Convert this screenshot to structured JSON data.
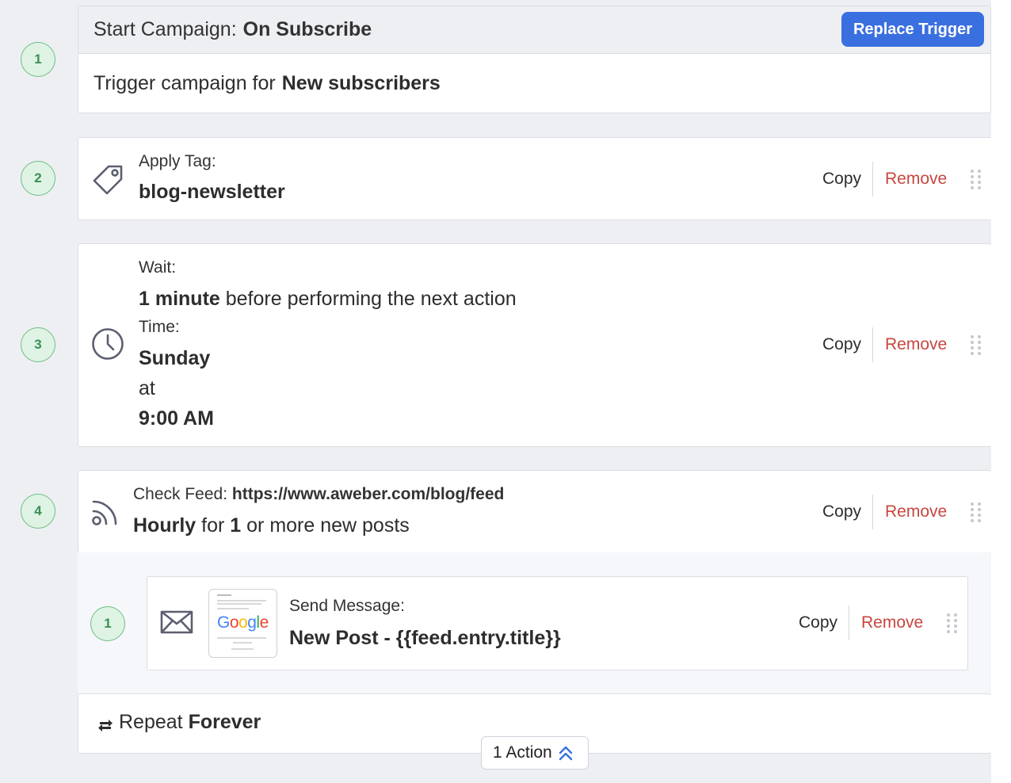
{
  "steps": {
    "n1": "1",
    "n2": "2",
    "n3": "3",
    "n4": "4",
    "nested_n1": "1"
  },
  "trigger": {
    "prefix": "Start Campaign:",
    "name": "On Subscribe",
    "replace_label": "Replace Trigger",
    "body_prefix": "Trigger campaign for",
    "body_value": "New subscribers"
  },
  "tag": {
    "label": "Apply Tag:",
    "value": "blog-newsletter"
  },
  "wait": {
    "label": "Wait:",
    "amount": "1 minute",
    "suffix": "before performing the next action",
    "time_label": "Time:",
    "day": "Sunday",
    "at": "at",
    "time": "9:00 AM"
  },
  "feed": {
    "label": "Check Feed:",
    "url": "https://www.aweber.com/blog/feed",
    "frequency": "Hourly",
    "for": "for",
    "count": "1",
    "suffix": "or more new posts"
  },
  "message": {
    "label": "Send Message:",
    "value": "New Post - {{feed.entry.title}}",
    "thumb_logo": "Google"
  },
  "repeat": {
    "prefix": "Repeat",
    "value": "Forever"
  },
  "actions": {
    "copy": "Copy",
    "remove": "Remove"
  },
  "collapse": {
    "label": "1 Action"
  },
  "icons": {
    "tag": "tag-icon",
    "wait": "clock-icon",
    "feed": "rss-icon",
    "message": "envelope-icon",
    "repeat": "repeat-icon",
    "drag": "drag-handle-icon",
    "collapse": "chevrons-up-icon"
  },
  "colors": {
    "primary": "#3a6fe0",
    "remove": "#c8463f",
    "step_bg": "#dff3e4",
    "step_border": "#6cbf84"
  }
}
